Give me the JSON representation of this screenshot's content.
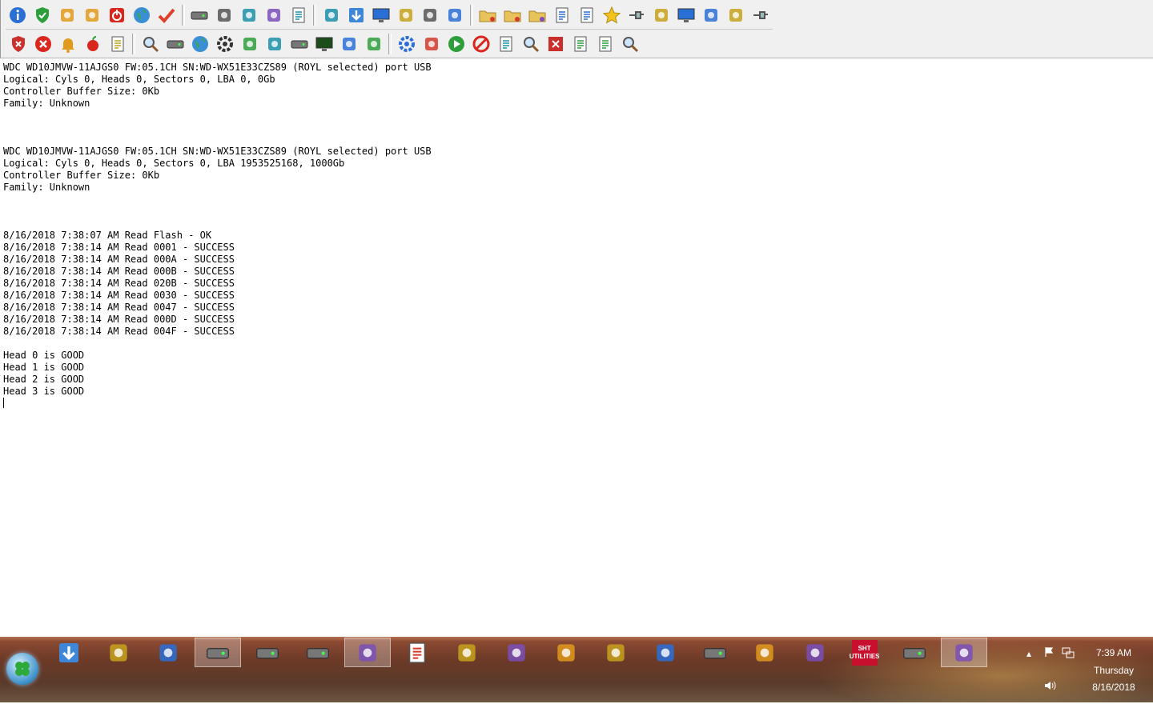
{
  "toolbar": {
    "row1": [
      "info-icon",
      "shield-check-icon",
      "tools-icon",
      "run-icon",
      "power-icon",
      "globe-icon",
      "checkmark-icon",
      "sep",
      "memory-icon",
      "hex-editor-icon",
      "gauge-icon",
      "tree-add-icon",
      "notepad-pencil-icon",
      "sep",
      "servo-icon",
      "download-icon",
      "monitor-icon",
      "copy-window-icon",
      "network-card-icon",
      "scanner-icon",
      "sep",
      "database-edit-icon",
      "folder-save-icon",
      "folder-add-icon",
      "clipboard-icon",
      "table-icon",
      "star-icon",
      "pin-icon",
      "wrench-tube-icon",
      "computer-check-icon",
      "molecule-icon",
      "window-icon",
      "plug-icon"
    ],
    "row2": [
      "shield-x-icon",
      "stop-icon",
      "bell-icon",
      "apple-icon",
      "export-page-icon",
      "sep",
      "magnifier-mouse-icon",
      "disk-icon",
      "earth-icon",
      "gear-icon",
      "pencil-icon",
      "tree-node-icon",
      "drive-icon",
      "terminal-icon",
      "clock-back-icon",
      "cube-icon",
      "sep",
      "refresh-icon",
      "car-icon",
      "play-icon",
      "forbidden-icon",
      "book-icon",
      "search-doc-icon",
      "close-box-icon",
      "edit-doc-icon",
      "scroll-icon",
      "search-icon"
    ]
  },
  "log_lines": [
    "WDC WD10JMVW-11AJGS0 FW:05.1CH SN:WD-WX51E33CZS89 (ROYL selected) port USB",
    "Logical: Cyls 0, Heads 0, Sectors 0, LBA 0, 0Gb",
    "Controller Buffer Size: 0Kb",
    "Family: Unknown",
    "",
    "",
    "",
    "WDC WD10JMVW-11AJGS0 FW:05.1CH SN:WD-WX51E33CZS89 (ROYL selected) port USB",
    "Logical: Cyls 0, Heads 0, Sectors 0, LBA 1953525168, 1000Gb",
    "Controller Buffer Size: 0Kb",
    "Family: Unknown",
    "",
    "",
    "",
    "8/16/2018 7:38:07 AM Read Flash - OK",
    "8/16/2018 7:38:14 AM Read 0001 - SUCCESS",
    "8/16/2018 7:38:14 AM Read 000A - SUCCESS",
    "8/16/2018 7:38:14 AM Read 000B - SUCCESS",
    "8/16/2018 7:38:14 AM Read 020B - SUCCESS",
    "8/16/2018 7:38:14 AM Read 0030 - SUCCESS",
    "8/16/2018 7:38:14 AM Read 0047 - SUCCESS",
    "8/16/2018 7:38:14 AM Read 000D - SUCCESS",
    "8/16/2018 7:38:14 AM Read 004F - SUCCESS",
    "",
    "Head 0 is GOOD",
    "Head 1 is GOOD",
    "Head 2 is GOOD",
    "Head 3 is GOOD"
  ],
  "taskbar": {
    "start_icon": "clover-start-icon",
    "apps": [
      {
        "icon": "download-manager-icon",
        "active": false
      },
      {
        "icon": "file-explorer-icon",
        "active": false
      },
      {
        "icon": "green-cross-icon",
        "active": false
      },
      {
        "icon": "hard-drive-tool-icon",
        "active": true
      },
      {
        "icon": "disk-utility-icon",
        "active": false
      },
      {
        "icon": "disk-utility-2-icon",
        "active": false
      },
      {
        "icon": "chrome-icon",
        "active": true
      },
      {
        "icon": "notepad-window-icon",
        "active": false
      },
      {
        "icon": "eye-diamond-icon",
        "active": false
      },
      {
        "icon": "word-icon",
        "active": false
      },
      {
        "icon": "utorrent-icon",
        "active": false
      },
      {
        "icon": "circle-logo-icon",
        "active": false
      },
      {
        "icon": "usb-adapter-icon",
        "active": false
      },
      {
        "icon": "drive-case-icon",
        "active": false
      },
      {
        "icon": "usb-adapter-2-icon",
        "active": false
      },
      {
        "icon": "seagate-icon",
        "active": false
      },
      {
        "icon": "sht-utilities-icon",
        "label": "SHT UTILITIES",
        "active": false
      },
      {
        "icon": "hard-drive-tool-2-icon",
        "active": false
      },
      {
        "icon": "server-tool-icon",
        "active": true
      }
    ],
    "clock": {
      "time": "7:39 AM",
      "day": "Thursday",
      "date": "8/16/2018"
    }
  },
  "colors": {
    "toolbar_bg": "#f0f0f0",
    "log_text": "#000000",
    "taskbar": "#6d3a27",
    "clock_text": "#ffffff"
  }
}
